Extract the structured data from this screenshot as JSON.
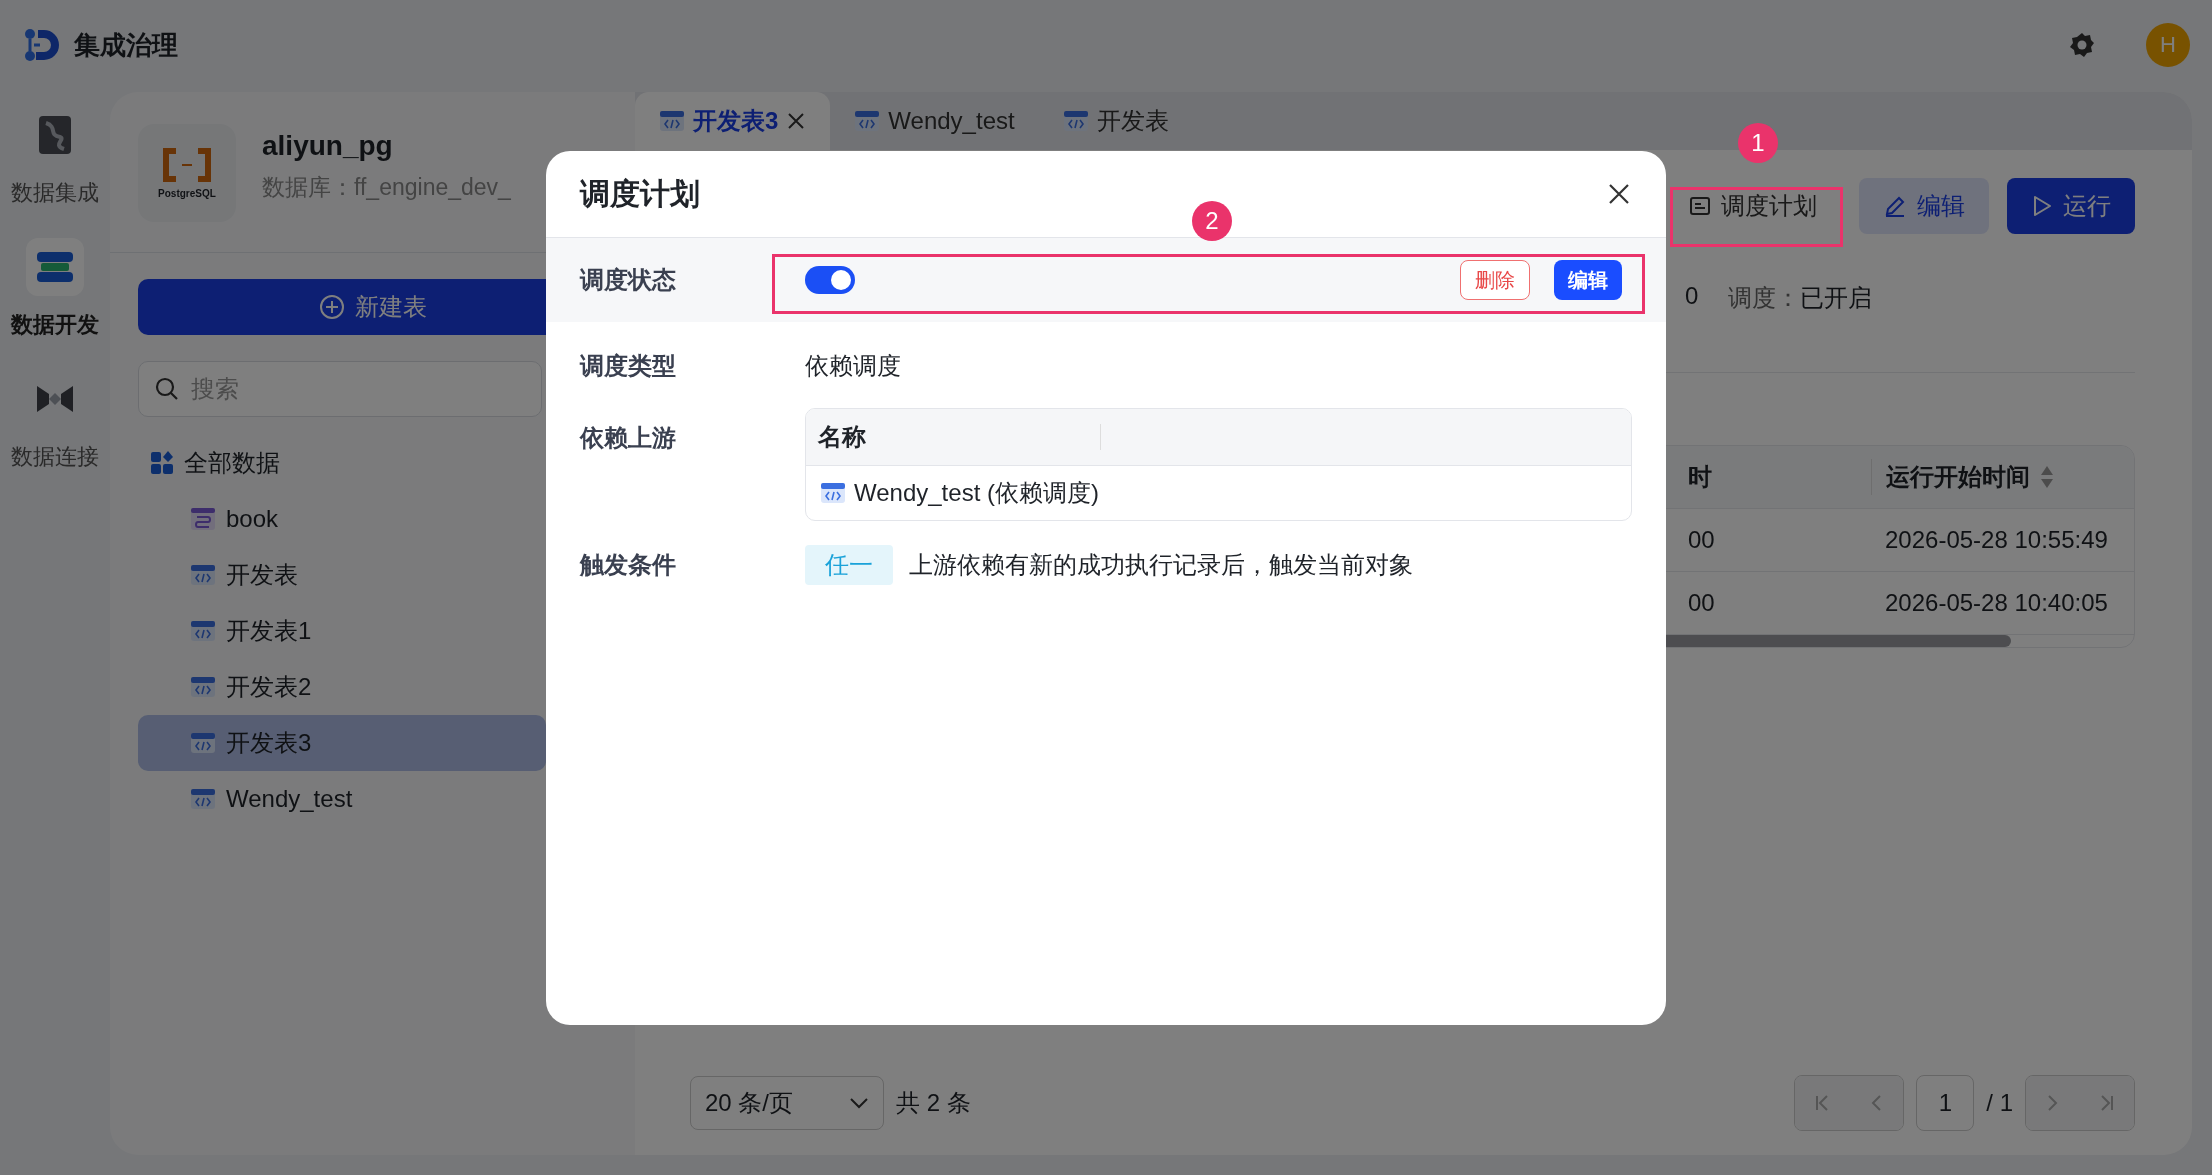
{
  "app": {
    "title": "集成治理"
  },
  "header": {
    "avatar": "H"
  },
  "rail": [
    {
      "label": "数据集成",
      "kind": "integrate",
      "selected": false
    },
    {
      "label": "数据开发",
      "kind": "develop",
      "selected": true
    },
    {
      "label": "数据连接",
      "kind": "connect",
      "selected": false
    }
  ],
  "datasource": {
    "logo_caption": "PostgreSQL",
    "name": "aliyun_pg",
    "database": "数据库：ff_engine_dev_"
  },
  "new_button": "新建表",
  "search": {
    "placeholder": "搜索"
  },
  "tree": {
    "label": "全部数据",
    "children": [
      {
        "label": "book",
        "kind": "table",
        "selected": false
      },
      {
        "label": "开发表",
        "kind": "dev",
        "selected": false
      },
      {
        "label": "开发表1",
        "kind": "dev",
        "selected": false
      },
      {
        "label": "开发表2",
        "kind": "dev",
        "selected": false
      },
      {
        "label": "开发表3",
        "kind": "dev",
        "selected": true
      },
      {
        "label": "Wendy_test",
        "kind": "dev",
        "selected": false
      }
    ]
  },
  "tabs": [
    {
      "label": "开发表3",
      "selected": true,
      "closable": true
    },
    {
      "label": "Wendy_test",
      "selected": false,
      "closable": false
    },
    {
      "label": "开发表",
      "selected": false,
      "closable": false
    }
  ],
  "toolbar": [
    {
      "label": "调度计划",
      "kind": "schedule"
    },
    {
      "label": "编辑",
      "kind": "edit"
    },
    {
      "label": "运行",
      "kind": "run"
    }
  ],
  "info": {
    "fragment": "0",
    "schedule_label": "调度：",
    "schedule_value": "已开启"
  },
  "table": {
    "columns": [
      {
        "label": "时"
      },
      {
        "label": "运行开始时间",
        "sortable": true
      }
    ],
    "rows": [
      [
        "00",
        "2026-05-28 10:55:49"
      ],
      [
        "00",
        "2026-05-28 10:40:05"
      ]
    ]
  },
  "pagination": {
    "page_size": "20 条/页",
    "total": "共 2 条",
    "page": "1",
    "pages": "/ 1"
  },
  "modal": {
    "title": "调度计划",
    "status": {
      "label": "调度状态",
      "on": true,
      "delete": "删除",
      "edit": "编辑"
    },
    "type": {
      "label": "调度类型",
      "value": "依赖调度"
    },
    "upstream": {
      "label": "依赖上游",
      "column": "名称",
      "rows": [
        "Wendy_test (依赖调度)"
      ]
    },
    "trigger": {
      "label": "触发条件",
      "tag": "任一",
      "text": "上游依赖有新的成功执行记录后，触发当前对象"
    }
  },
  "annotations": [
    {
      "number": "1"
    },
    {
      "number": "2"
    }
  ]
}
